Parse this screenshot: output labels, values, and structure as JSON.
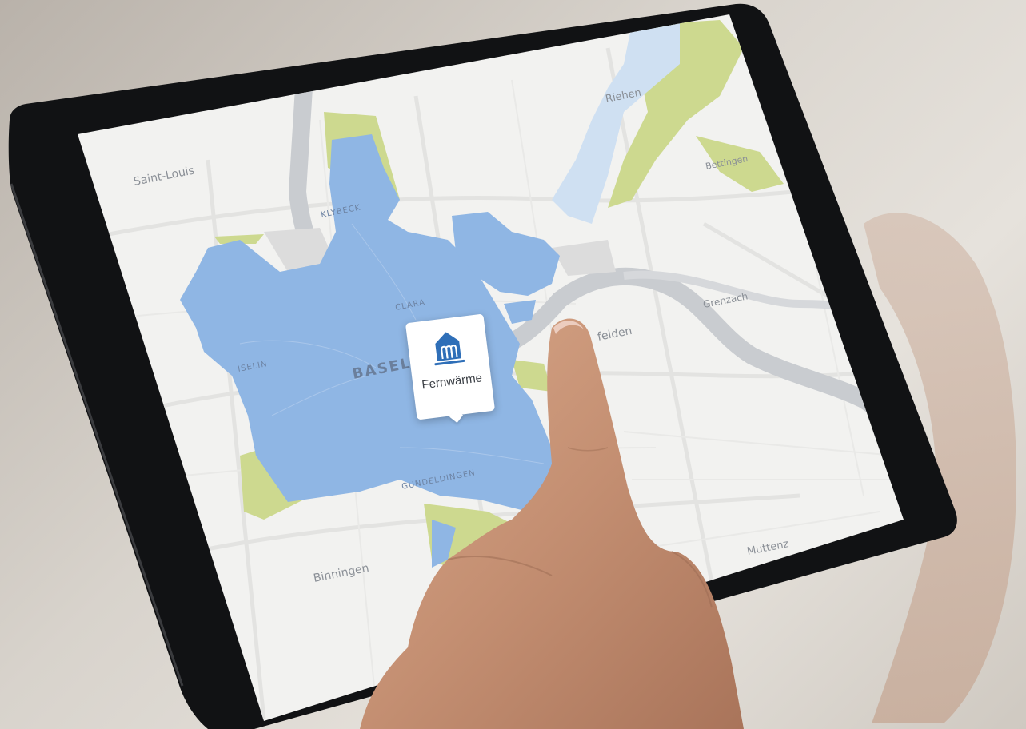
{
  "map": {
    "places": {
      "saint_louis": "Saint-Louis",
      "riehen": "Riehen",
      "bettingen": "Bettingen",
      "grenzach": "Grenzach",
      "rheinfelden_partial": "felden",
      "muttenz": "Muttenz",
      "binningen": "Binningen"
    },
    "districts": {
      "klybeck": "KLYBECK",
      "clara": "CLARA",
      "iselin": "ISELIN",
      "gundeldingen": "GUNDELDINGEN"
    },
    "city": "BASEL",
    "colors": {
      "district_heating_area": "#8fb6e4",
      "planned_area": "#cfe0f2",
      "green_area": "#cdd98f",
      "river": "#c9ccd0",
      "map_background": "#f2f2f0"
    }
  },
  "popup": {
    "label": "Fernwärme",
    "icon": "district-heating-icon"
  }
}
